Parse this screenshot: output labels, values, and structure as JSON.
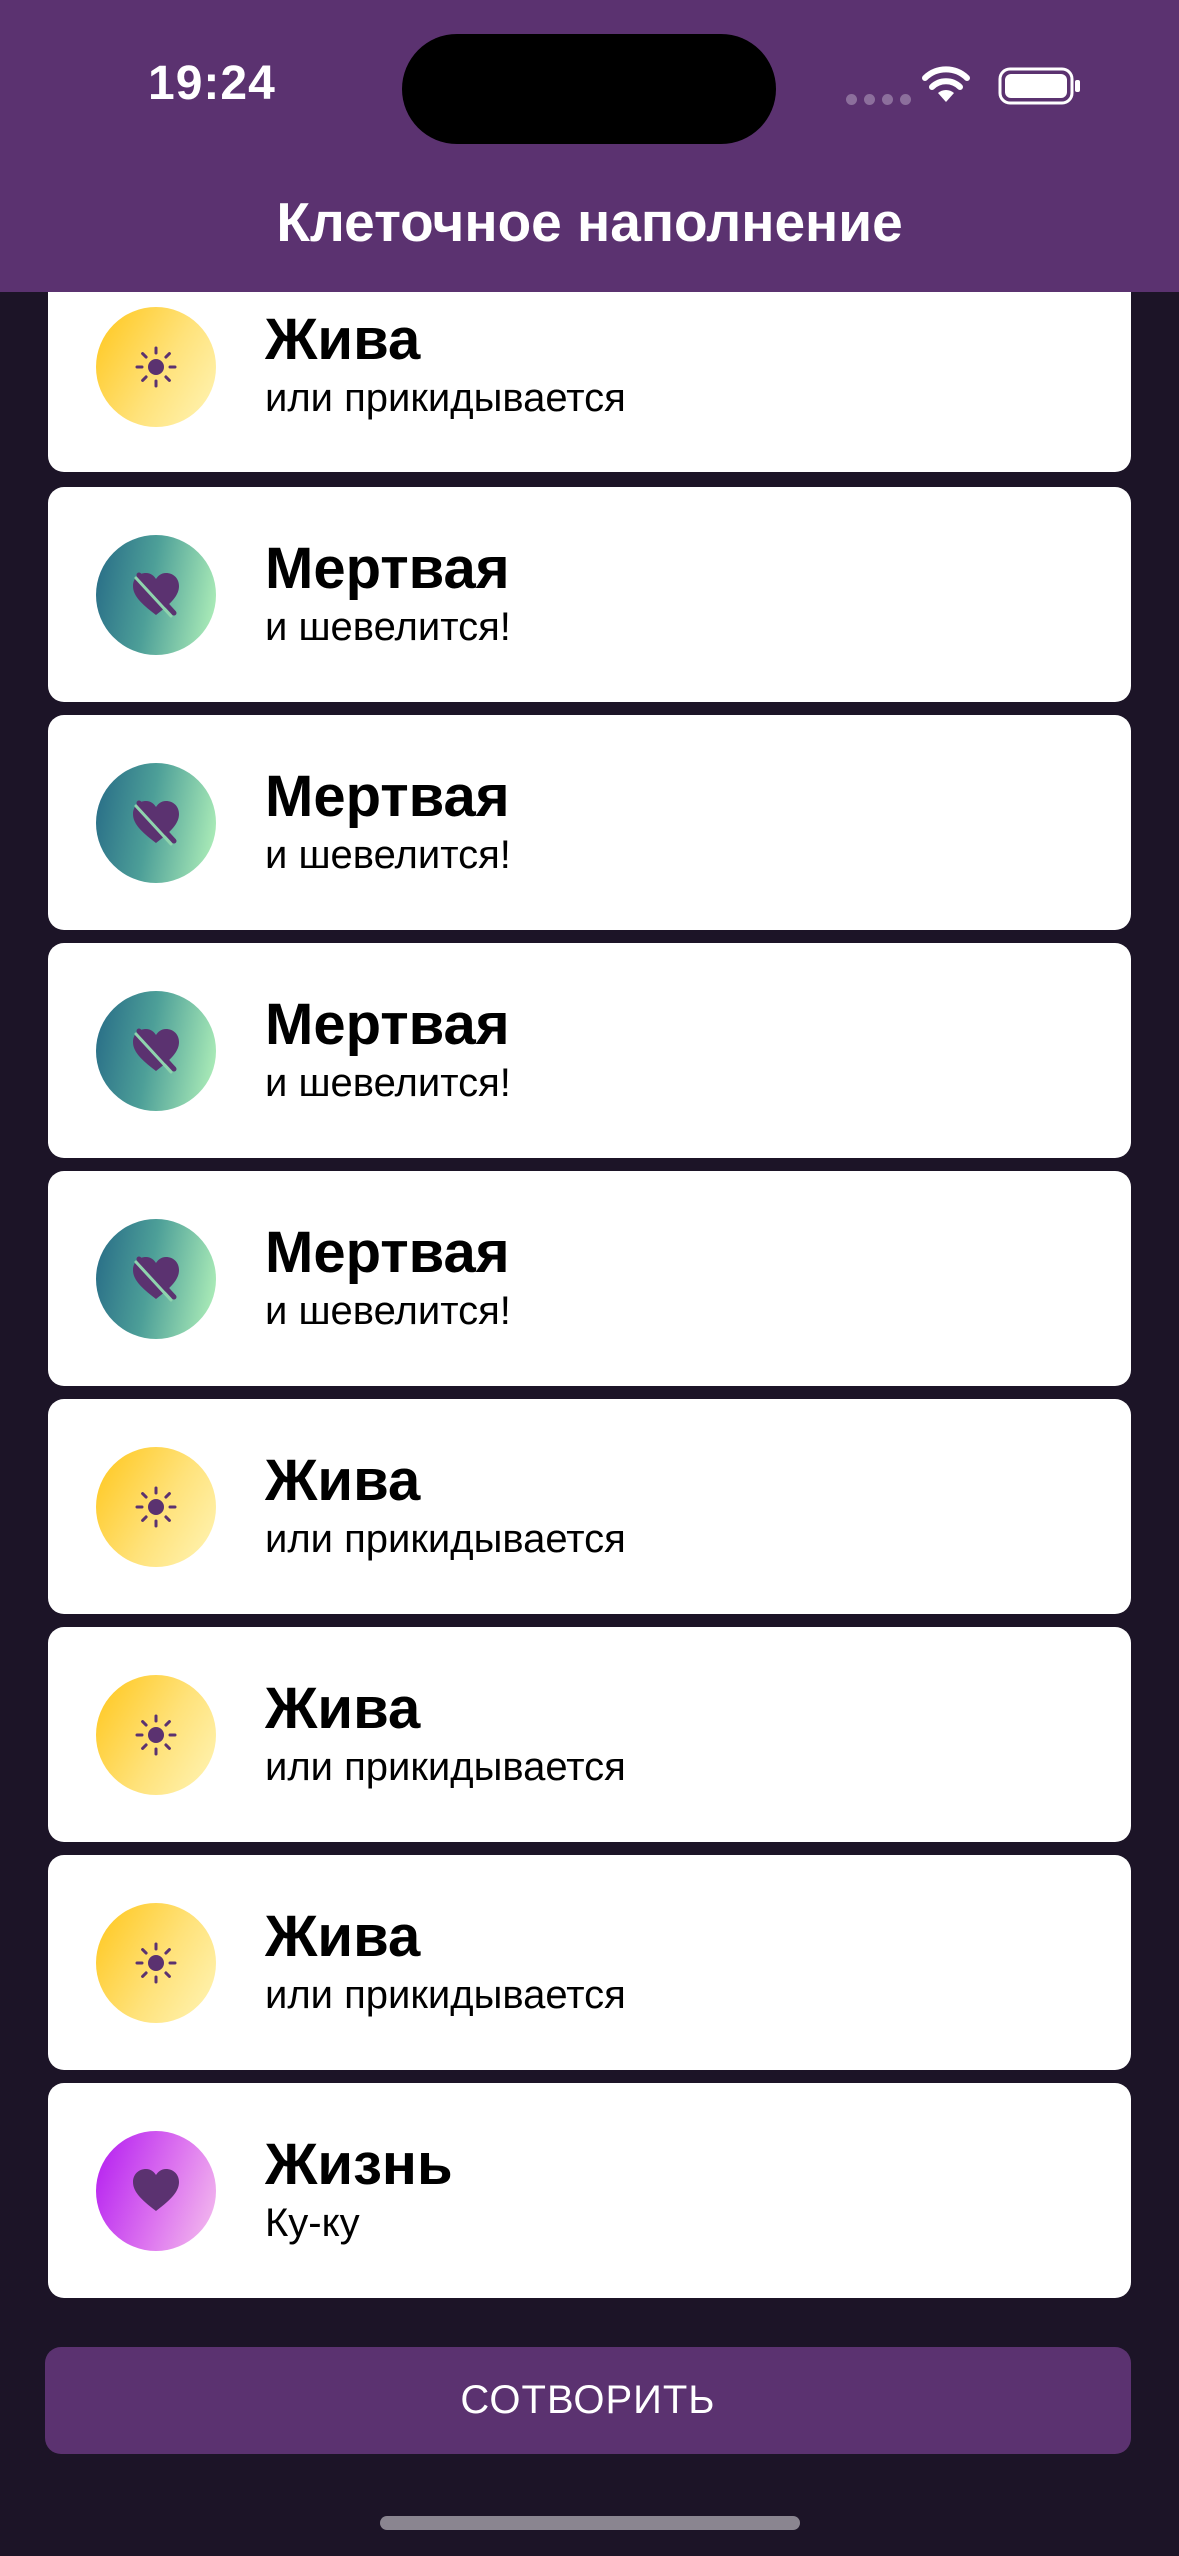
{
  "status_bar": {
    "time": "19:24"
  },
  "nav": {
    "title": "Клеточное наполнение"
  },
  "cells": [
    {
      "kind": "alive",
      "title": "Жива",
      "subtitle": "или прикидывается",
      "icon": "sun-icon"
    },
    {
      "kind": "dead",
      "title": "Мертвая",
      "subtitle": "и шевелится!",
      "icon": "heart-slash-icon"
    },
    {
      "kind": "dead",
      "title": "Мертвая",
      "subtitle": "и шевелится!",
      "icon": "heart-slash-icon"
    },
    {
      "kind": "dead",
      "title": "Мертвая",
      "subtitle": "и шевелится!",
      "icon": "heart-slash-icon"
    },
    {
      "kind": "dead",
      "title": "Мертвая",
      "subtitle": "и шевелится!",
      "icon": "heart-slash-icon"
    },
    {
      "kind": "alive",
      "title": "Жива",
      "subtitle": "или прикидывается",
      "icon": "sun-icon"
    },
    {
      "kind": "alive",
      "title": "Жива",
      "subtitle": "или прикидывается",
      "icon": "sun-icon"
    },
    {
      "kind": "alive",
      "title": "Жива",
      "subtitle": "или прикидывается",
      "icon": "sun-icon"
    },
    {
      "kind": "life",
      "title": "Жизнь",
      "subtitle": "Ку-ку",
      "icon": "heart-icon"
    }
  ],
  "action": {
    "create_label": "СОТВОРИТЬ"
  },
  "colors": {
    "accent": "#5b3270",
    "background": "#1c1427"
  }
}
